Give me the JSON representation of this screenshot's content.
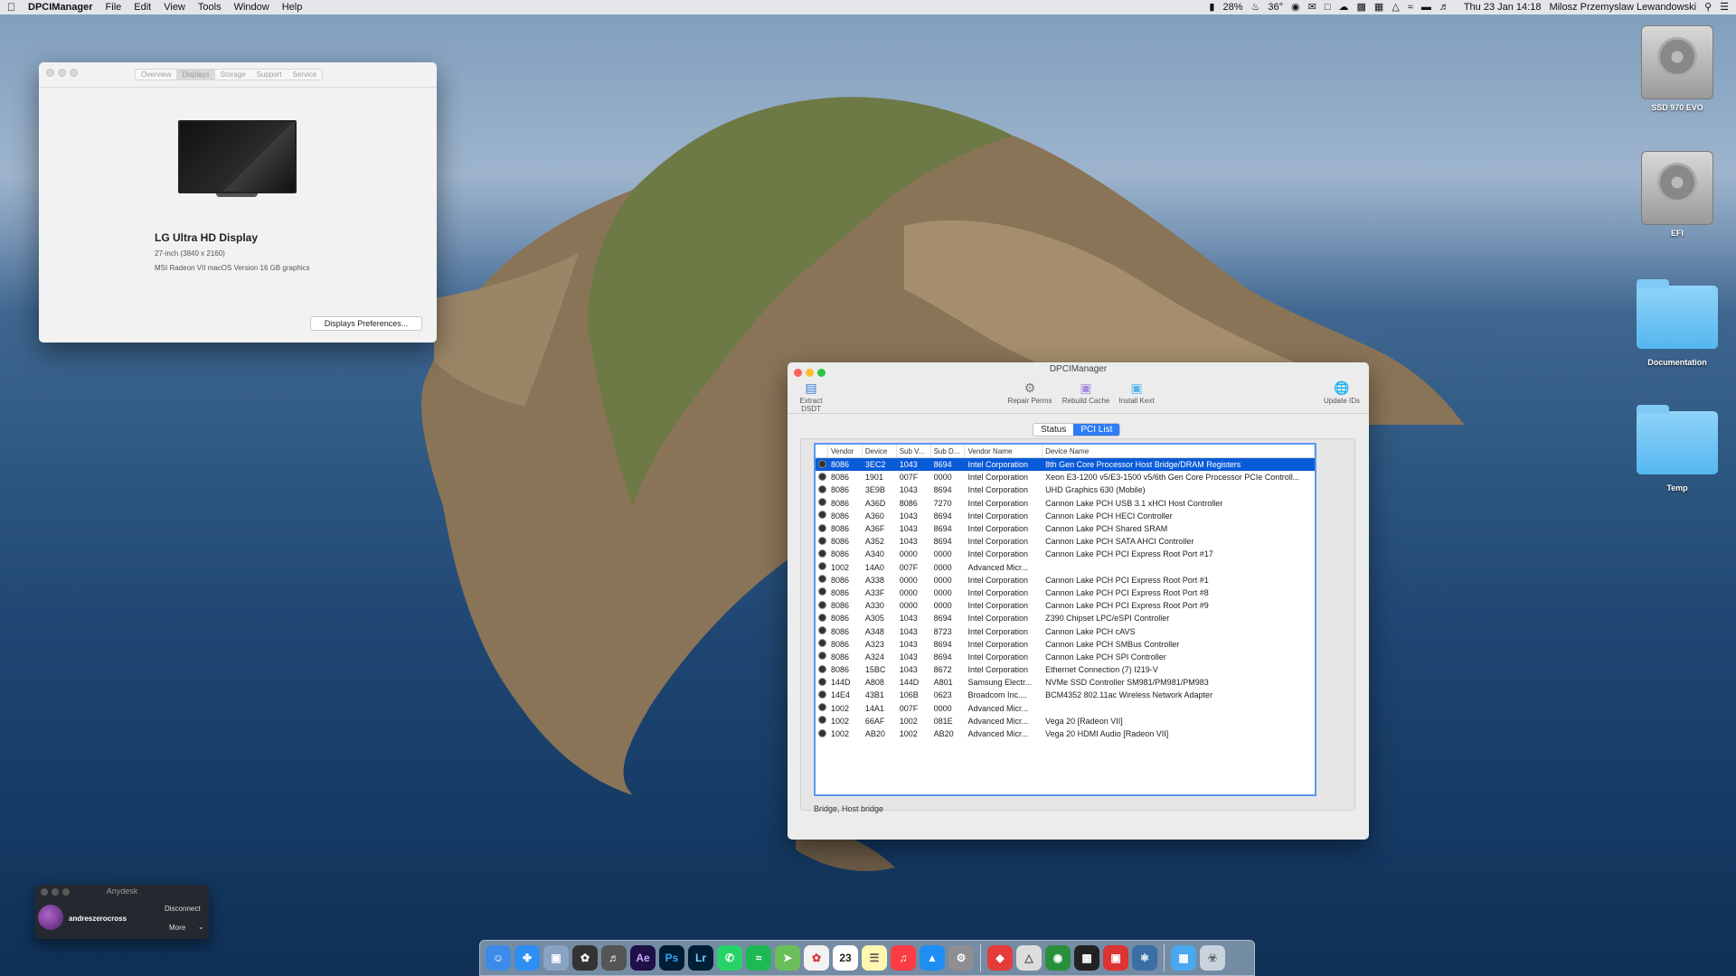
{
  "menubar": {
    "apple": "",
    "app": "DPCIManager",
    "menus": [
      "File",
      "Edit",
      "View",
      "Tools",
      "Window",
      "Help"
    ],
    "battery": "28%",
    "temperature": "36°",
    "datetime": "Thu 23 Jan  14:18",
    "user": "Milosz Przemyslaw Lewandowski"
  },
  "about_window": {
    "tabs": [
      "Overview",
      "Displays",
      "Storage",
      "Support",
      "Service"
    ],
    "active_tab": "Displays",
    "display_name": "LG Ultra HD Display",
    "display_resolution": "27-inch (3840 x 2160)",
    "display_gpu": "MSI Radeon VII macOS Version 16 GB graphics",
    "prefs_button": "Displays Preferences..."
  },
  "dpci": {
    "title": "DPCIManager",
    "toolbar": {
      "extract": "Extract DSDT",
      "repair": "Repair Perms",
      "rebuild": "Rebuild Cache",
      "install": "Install Kext",
      "update": "Update IDs"
    },
    "tabs": [
      "Status",
      "PCI List"
    ],
    "active_tab": "PCI List",
    "columns": [
      "Vendor",
      "Device",
      "Sub V...",
      "Sub D...",
      "Vendor Name",
      "Device Name"
    ],
    "rows": [
      [
        "8086",
        "3EC2",
        "1043",
        "8694",
        "Intel Corporation",
        "8th Gen Core Processor Host Bridge/DRAM Registers"
      ],
      [
        "8086",
        "1901",
        "007F",
        "0000",
        "Intel Corporation",
        "Xeon E3-1200 v5/E3-1500 v5/6th Gen Core Processor PCIe Controll..."
      ],
      [
        "8086",
        "3E9B",
        "1043",
        "8694",
        "Intel Corporation",
        "UHD Graphics 630 (Mobile)"
      ],
      [
        "8086",
        "A36D",
        "8086",
        "7270",
        "Intel Corporation",
        "Cannon Lake PCH USB 3.1 xHCI Host Controller"
      ],
      [
        "8086",
        "A360",
        "1043",
        "8694",
        "Intel Corporation",
        "Cannon Lake PCH HECI Controller"
      ],
      [
        "8086",
        "A36F",
        "1043",
        "8694",
        "Intel Corporation",
        "Cannon Lake PCH Shared SRAM"
      ],
      [
        "8086",
        "A352",
        "1043",
        "8694",
        "Intel Corporation",
        "Cannon Lake PCH SATA AHCI Controller"
      ],
      [
        "8086",
        "A340",
        "0000",
        "0000",
        "Intel Corporation",
        "Cannon Lake PCH PCI Express Root Port #17"
      ],
      [
        "1002",
        "14A0",
        "007F",
        "0000",
        "Advanced Micr...",
        ""
      ],
      [
        "8086",
        "A338",
        "0000",
        "0000",
        "Intel Corporation",
        "Cannon Lake PCH PCI Express Root Port #1"
      ],
      [
        "8086",
        "A33F",
        "0000",
        "0000",
        "Intel Corporation",
        "Cannon Lake PCH PCI Express Root Port #8"
      ],
      [
        "8086",
        "A330",
        "0000",
        "0000",
        "Intel Corporation",
        "Cannon Lake PCH PCI Express Root Port #9"
      ],
      [
        "8086",
        "A305",
        "1043",
        "8694",
        "Intel Corporation",
        "Z390 Chipset LPC/eSPI Controller"
      ],
      [
        "8086",
        "A348",
        "1043",
        "8723",
        "Intel Corporation",
        "Cannon Lake PCH cAVS"
      ],
      [
        "8086",
        "A323",
        "1043",
        "8694",
        "Intel Corporation",
        "Cannon Lake PCH SMBus Controller"
      ],
      [
        "8086",
        "A324",
        "1043",
        "8694",
        "Intel Corporation",
        "Cannon Lake PCH SPI Controller"
      ],
      [
        "8086",
        "15BC",
        "1043",
        "8672",
        "Intel Corporation",
        "Ethernet Connection (7) I219-V"
      ],
      [
        "144D",
        "A808",
        "144D",
        "A801",
        "Samsung Electr...",
        "NVMe SSD Controller SM981/PM981/PM983"
      ],
      [
        "14E4",
        "43B1",
        "106B",
        "0623",
        "Broadcom Inc....",
        "BCM4352 802.11ac Wireless Network Adapter"
      ],
      [
        "1002",
        "14A1",
        "007F",
        "0000",
        "Advanced Micr...",
        ""
      ],
      [
        "1002",
        "66AF",
        "1002",
        "081E",
        "Advanced Micr...",
        "Vega 20 [Radeon VII]"
      ],
      [
        "1002",
        "AB20",
        "1002",
        "AB20",
        "Advanced Micr...",
        "Vega 20 HDMI Audio [Radeon VII]"
      ]
    ],
    "status_text": "Bridge, Host bridge"
  },
  "desktop": {
    "icons": [
      "SSD 970 EVO",
      "EFI",
      "Documentation",
      "Temp"
    ]
  },
  "anydesk": {
    "title": "Anydesk",
    "user": "andreszerocross",
    "disconnect": "Disconnect",
    "more": "More"
  },
  "dock": {
    "labels": [
      "Ae",
      "Ps",
      "Lr"
    ],
    "calendar_day": "23"
  },
  "colors": {
    "selection": "#0a5bd8",
    "tab_active": "#2f7cf6",
    "table_focus": "#5b96f2"
  }
}
